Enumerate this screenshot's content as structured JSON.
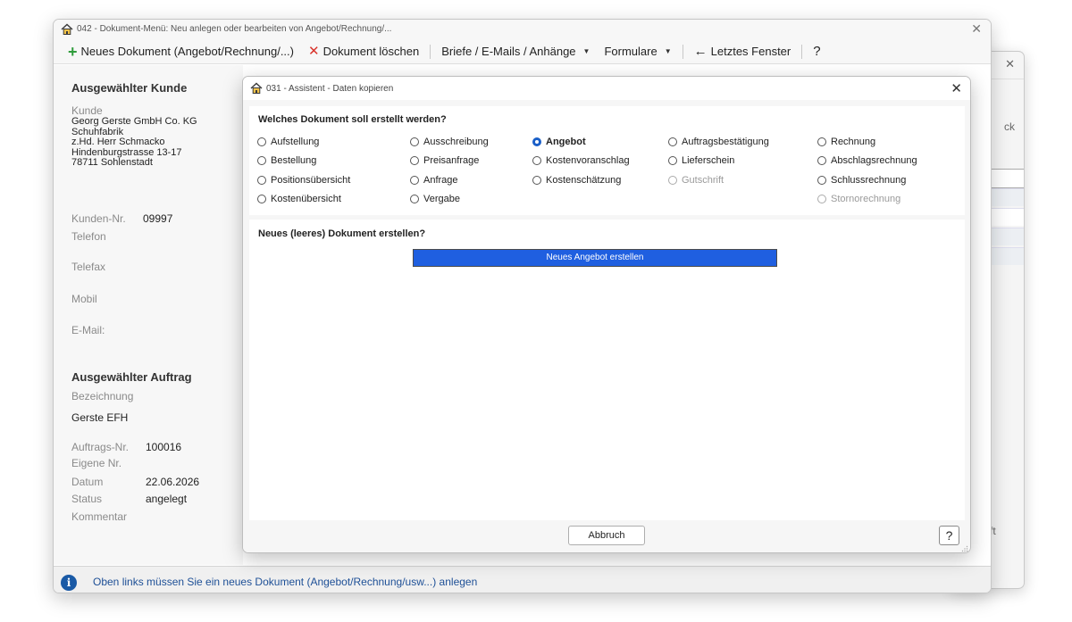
{
  "background_window": {
    "partial_text_1": "ck",
    "partial_text_2": "ft"
  },
  "main_window": {
    "title": "042  -  Dokument-Menü: Neu anlegen oder bearbeiten von Angebot/Rechnung/...",
    "toolbar": {
      "new_document": "Neues Dokument (Angebot/Rechnung/...)",
      "delete_document": "Dokument löschen",
      "letters": "Briefe / E-Mails / Anhänge",
      "forms": "Formulare",
      "last_window": "Letztes Fenster",
      "help": "?"
    }
  },
  "customer": {
    "heading": "Ausgewählter Kunde",
    "label": "Kunde",
    "address": [
      "Georg Gerste GmbH  Co. KG",
      "Schuhfabrik",
      "z.Hd. Herr Schmacko",
      "Hindenburgstrasse 13-17",
      "78711 Sohlenstadt"
    ],
    "number_label": "Kunden-Nr.",
    "number": "09997",
    "phone_label": "Telefon",
    "fax_label": "Telefax",
    "mobile_label": "Mobil",
    "email_label": "E-Mail:"
  },
  "order": {
    "heading": "Ausgewählter Auftrag",
    "designation_label": "Bezeichnung",
    "designation": "Gerste EFH",
    "order_no_label": "Auftrags-Nr.",
    "order_no": "100016",
    "own_no_label": "Eigene Nr.",
    "date_label": "Datum",
    "date": "22.06.2026",
    "status_label": "Status",
    "status": "angelegt",
    "comment_label": "Kommentar"
  },
  "status_bar": {
    "icon": "info-icon",
    "message": "Oben links müssen Sie ein neues Dokument (Angebot/Rechnung/usw...) anlegen"
  },
  "dialog": {
    "title": "031  -  Assistent - Daten kopieren",
    "question": "Welches Dokument soll erstellt werden?",
    "options": [
      {
        "label": "Aufstellung",
        "state": "normal"
      },
      {
        "label": "Ausschreibung",
        "state": "normal"
      },
      {
        "label": "Angebot",
        "state": "selected"
      },
      {
        "label": "Auftragsbestätigung",
        "state": "normal"
      },
      {
        "label": "Rechnung",
        "state": "normal"
      },
      {
        "label": "Bestellung",
        "state": "normal"
      },
      {
        "label": "Preisanfrage",
        "state": "normal"
      },
      {
        "label": "Kostenvoranschlag",
        "state": "normal"
      },
      {
        "label": "Lieferschein",
        "state": "normal"
      },
      {
        "label": "Abschlagsrechnung",
        "state": "normal"
      },
      {
        "label": "Positionsübersicht",
        "state": "normal"
      },
      {
        "label": "Anfrage",
        "state": "normal"
      },
      {
        "label": "Kostenschätzung",
        "state": "normal"
      },
      {
        "label": "Gutschrift",
        "state": "disabled"
      },
      {
        "label": "Schlussrechnung",
        "state": "normal"
      },
      {
        "label": "Kostenübersicht",
        "state": "normal"
      },
      {
        "label": "Vergabe",
        "state": "normal"
      },
      {
        "label": "Stornorechnung",
        "state": "disabled"
      }
    ],
    "new_doc_question": "Neues (leeres) Dokument erstellen?",
    "create_button": "Neues Angebot erstellen",
    "cancel_button": "Abbruch",
    "help_button": "?",
    "colors": {
      "accent": "#1f5fe0",
      "radio_selected": "#1a5fc8"
    }
  }
}
